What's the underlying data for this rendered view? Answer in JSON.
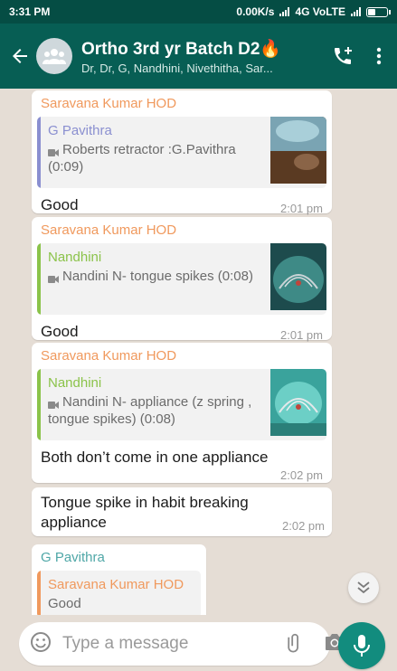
{
  "status_bar": {
    "time": "3:31 PM",
    "network": "0.00K/s",
    "carrier": "4G VoLTE"
  },
  "header": {
    "title": "Ortho 3rd yr Batch D2🔥",
    "subtitle": "Dr, Dr, G, Nandhini, Nivethitha, Sar..."
  },
  "messages": [
    {
      "sender": "Saravana Kumar HOD",
      "quote_author": "G Pavithra",
      "quote_text": "Roberts retractor :G.Pavithra (0:09)",
      "text": "Good",
      "time": "2:01 pm"
    },
    {
      "sender": "Saravana Kumar HOD",
      "quote_author": "Nandhini",
      "quote_text": "Nandini N- tongue spikes (0:08)",
      "text": "Good",
      "time": "2:01 pm"
    },
    {
      "sender": "Saravana Kumar HOD",
      "quote_author": "Nandhini",
      "quote_text": "Nandini N- appliance (z spring , tongue spikes) (0:08)",
      "text": "Both don’t come in one appliance",
      "time": "2:02 pm"
    },
    {
      "text": "Tongue spike in habit breaking appliance",
      "time": "2:02 pm"
    },
    {
      "sender": "G Pavithra",
      "quote_author": "Saravana Kumar HOD",
      "quote_text": "Good"
    }
  ],
  "composer": {
    "placeholder": "Type a message"
  },
  "colors": {
    "header": "#075e54",
    "status_bar": "#054d44",
    "mic_button": "#128c7e",
    "sender_orange": "#f0995d",
    "quote_green": "#8bc34a",
    "quote_purple": "#8a8fd0"
  },
  "icons": {
    "back": "arrow-left-icon",
    "avatar": "group-avatar-icon",
    "call": "add-call-icon",
    "menu": "more-vert-icon",
    "emoji": "emoji-icon",
    "attach": "paperclip-icon",
    "camera": "camera-icon",
    "mic": "mic-icon",
    "scroll": "double-chevron-down-icon"
  }
}
